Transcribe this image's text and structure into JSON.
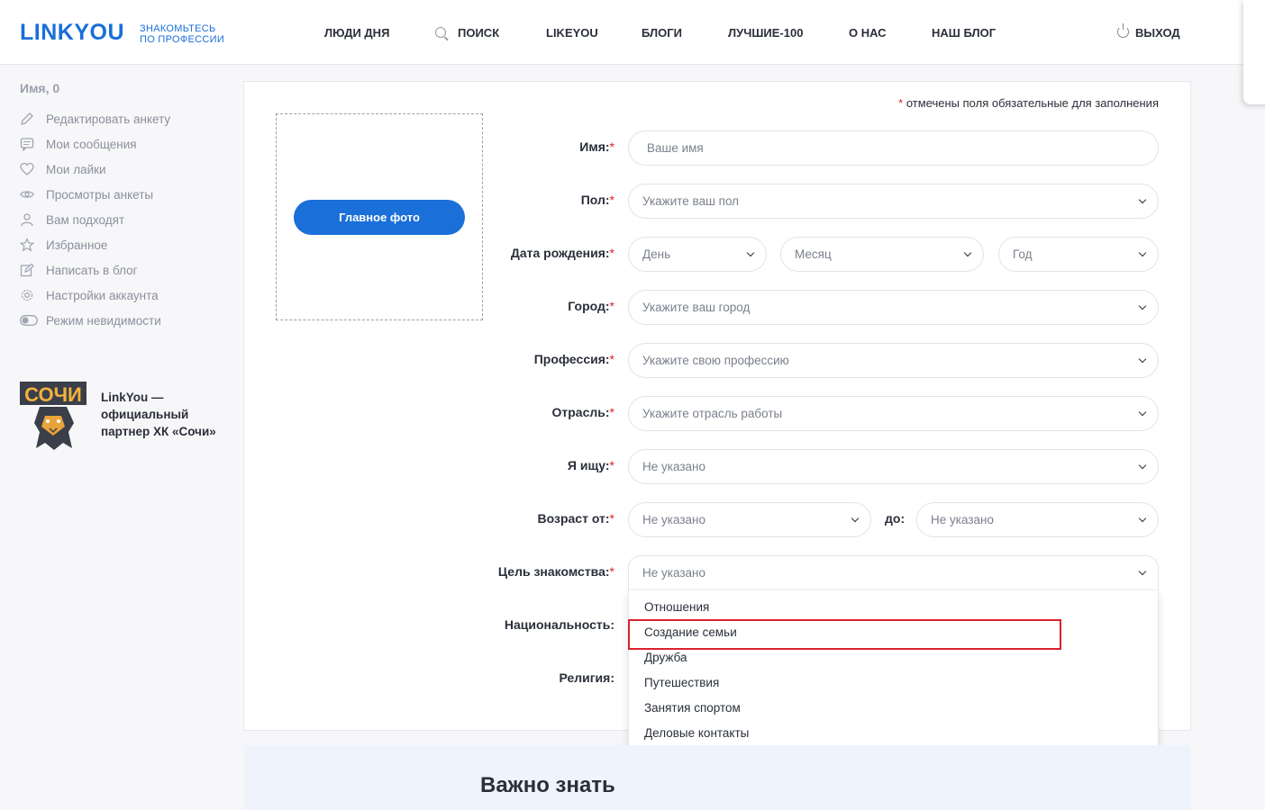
{
  "header": {
    "logo": "LINKYOU",
    "tagline_line1": "ЗНАКОМЬТЕСЬ",
    "tagline_line2": "ПО ПРОФЕССИИ",
    "nav": [
      "ЛЮДИ ДНЯ",
      "ПОИСК",
      "LIKEYOU",
      "БЛОГИ",
      "ЛУЧШИЕ-100",
      "О НАС",
      "НАШ БЛОГ"
    ],
    "logout": "ВЫХОД"
  },
  "sidebar": {
    "name": "Имя, 0",
    "items": [
      {
        "label": "Редактировать анкету",
        "icon": "pencil-icon"
      },
      {
        "label": "Мои сообщения",
        "icon": "message-icon"
      },
      {
        "label": "Мои лайки",
        "icon": "heart-icon"
      },
      {
        "label": "Просмотры анкеты",
        "icon": "eye-icon"
      },
      {
        "label": "Вам подходят",
        "icon": "user-icon"
      },
      {
        "label": "Избранное",
        "icon": "star-icon"
      },
      {
        "label": "Написать в блог",
        "icon": "edit-icon"
      },
      {
        "label": "Настройки аккаунта",
        "icon": "gear-icon"
      },
      {
        "label": "Режим невидимости",
        "icon": "toggle-icon"
      }
    ],
    "partner_text": "LinkYou — официальный партнер ХК «Сочи»",
    "partner_logo_text": "СОЧИ"
  },
  "form": {
    "required_note": "отмечены поля обязательные для заполнения",
    "star": "*",
    "photo_button": "Главное фото",
    "name_label": "Имя:",
    "name_placeholder": "Ваше имя",
    "gender_label": "Пол:",
    "gender_value": "Укажите ваш пол",
    "birth_label": "Дата рождения:",
    "birth_day": "День",
    "birth_month": "Месяц",
    "birth_year": "Год",
    "city_label": "Город:",
    "city_value": "Укажите ваш город",
    "profession_label": "Профессия:",
    "profession_value": "Укажите свою профессию",
    "industry_label": "Отрасль:",
    "industry_value": "Укажите отрасль работы",
    "seeking_label": "Я ищу:",
    "seeking_value": "Не указано",
    "age_from_label": "Возраст от:",
    "age_from_value": "Не указано",
    "age_to_label": "до:",
    "age_to_value": "Не указано",
    "goal_label": "Цель знакомства:",
    "goal_value": "Не указано",
    "nationality_label": "Национальность:",
    "religion_label": "Религия:"
  },
  "goal_dropdown": {
    "options": [
      "Отношения",
      "Создание семьи",
      "Дружба",
      "Путешествия",
      "Занятия спортом",
      "Деловые контакты"
    ],
    "highlighted": "Создание семьи"
  },
  "info": {
    "title": "Важно знать"
  },
  "colors": {
    "accent": "#1a6fd8",
    "required": "#d9232d"
  }
}
